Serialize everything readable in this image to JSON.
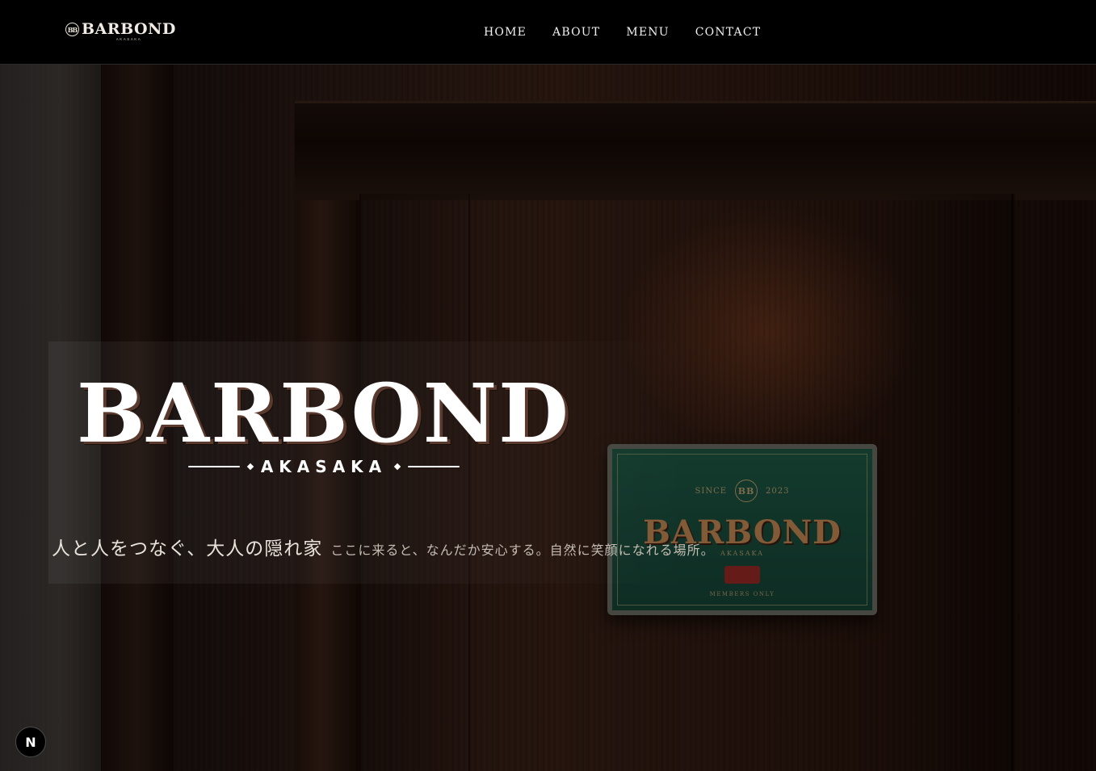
{
  "header": {
    "logo_mark": "BB",
    "logo_text": "BARBOND",
    "logo_sub": "AKASAKA",
    "nav": [
      "HOME",
      "ABOUT",
      "MENU",
      "CONTACT"
    ]
  },
  "hero": {
    "title": "BARBOND",
    "subtitle": "AKASAKA",
    "tagline_main": "人と人をつなぐ、大人の隠れ家",
    "tagline_sub": "ここに来ると、なんだか安心する。自然に笑顔になれる場所。",
    "plaque": {
      "since": "SINCE",
      "year": "2023",
      "mark": "BB",
      "name": "BARBOND",
      "sub": "AKASAKA",
      "foot": "MEMBERS ONLY"
    }
  },
  "badge": {
    "letter": "N"
  },
  "colors": {
    "header_bg": "#000000",
    "plaque_green": "#1f5a46",
    "wood": "#3a2016"
  }
}
